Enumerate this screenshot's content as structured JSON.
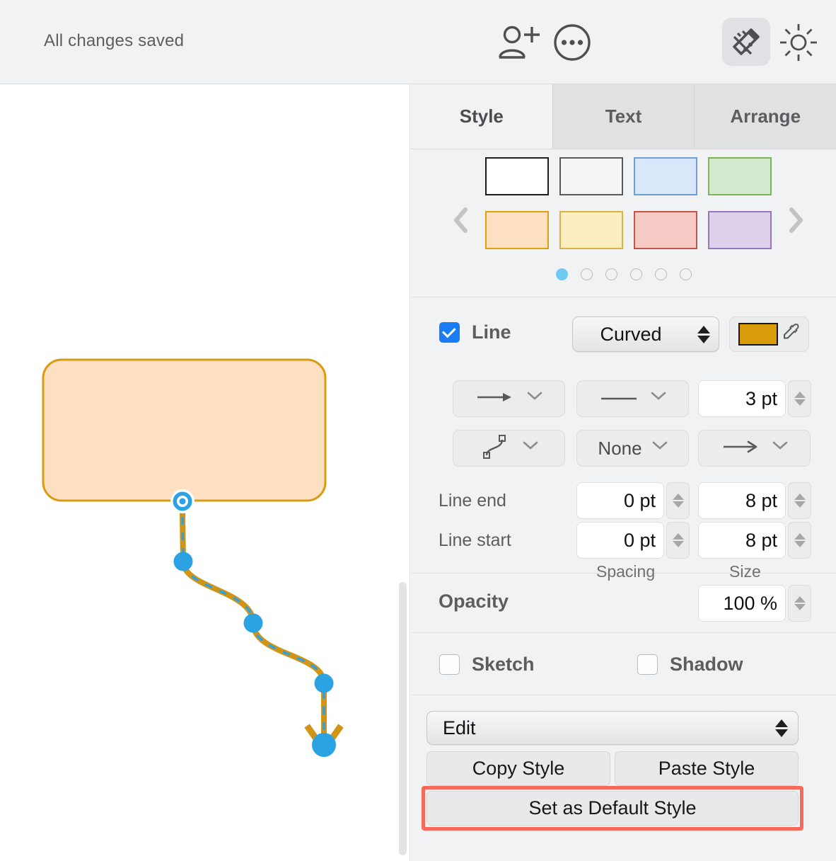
{
  "toolbar": {
    "saved_status": "All changes saved",
    "icons": [
      {
        "name": "add-person-icon",
        "label": "Add collaborator"
      },
      {
        "name": "more-options-icon",
        "label": "More options"
      },
      {
        "name": "inspector-icon",
        "label": "Format Inspector"
      },
      {
        "name": "brightness-icon",
        "label": "Appearance"
      }
    ]
  },
  "canvas": {
    "shape": {
      "type": "rounded-rectangle",
      "fill": "#fce0c1",
      "stroke": "#d99b12",
      "stroke_width": 3
    },
    "connector": {
      "type": "curved-line",
      "stroke": "#d19414",
      "selection_dash": "#2ba3e3",
      "stroke_width": 7,
      "arrow_end": "arrow",
      "handles": 5
    },
    "scrollbar": {
      "name": "vertical-scrollbar"
    }
  },
  "inspector": {
    "tabs": [
      {
        "label": "Style",
        "active": true
      },
      {
        "label": "Text",
        "active": false
      },
      {
        "label": "Arrange",
        "active": false
      }
    ],
    "gallery": {
      "prev_label": "‹",
      "next_label": "›",
      "swatches": [
        {
          "name": "style-swatch-white",
          "fill": "#ffffff",
          "stroke": "#1b1c21"
        },
        {
          "name": "style-swatch-gray",
          "fill": "#f4f4f4",
          "stroke": "#58595c"
        },
        {
          "name": "style-swatch-blue",
          "fill": "#d9e7fa",
          "stroke": "#6f9ed6"
        },
        {
          "name": "style-swatch-green",
          "fill": "#d3e8cd",
          "stroke": "#7db359"
        },
        {
          "name": "style-swatch-orange",
          "fill": "#fce0c1",
          "stroke": "#dda10f"
        },
        {
          "name": "style-swatch-yellow",
          "fill": "#fdeec2",
          "stroke": "#d9b23f"
        },
        {
          "name": "style-swatch-red",
          "fill": "#f8cac5",
          "stroke": "#c2544c"
        },
        {
          "name": "style-swatch-purple",
          "fill": "#ddd1ec",
          "stroke": "#9478bb"
        }
      ],
      "page_count": 6,
      "active_page": 1,
      "active_dot_color": "#6fc9f0"
    },
    "line": {
      "checkbox_label": "Line",
      "checked": true,
      "shape_popup_value": "Curved",
      "color_swatch": "#d89b0a",
      "eyedropper": "eyedropper-icon",
      "arrow_style_value": "arrow-right-icon",
      "dash_style_value": "solid-line-icon",
      "width_value": "3 pt",
      "corner_style_value": "curved-corner-icon",
      "join_value": "None",
      "end_arrow_value": "arrow-right-icon",
      "line_end_label": "Line end",
      "line_start_label": "Line start",
      "line_end_spacing": "0 pt",
      "line_end_size": "8 pt",
      "line_start_spacing": "0 pt",
      "line_start_size": "8 pt",
      "spacing_label": "Spacing",
      "size_label": "Size"
    },
    "opacity": {
      "label": "Opacity",
      "value": "100 %"
    },
    "effects": {
      "sketch_label": "Sketch",
      "sketch_checked": false,
      "shadow_label": "Shadow",
      "shadow_checked": false
    },
    "actions": {
      "edit_menu_value": "Edit",
      "copy_style_label": "Copy Style",
      "paste_style_label": "Paste Style",
      "set_default_label": "Set as Default Style",
      "highlight_color": "#f9695a"
    }
  }
}
